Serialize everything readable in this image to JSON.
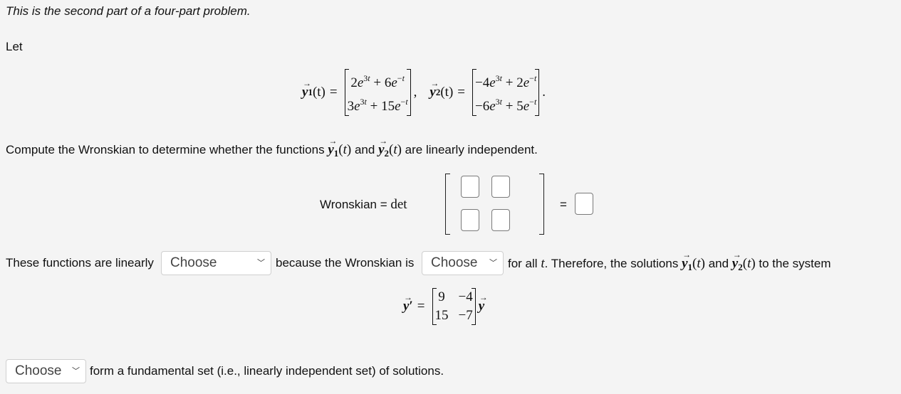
{
  "intro": "This is the second part of a four-part problem.",
  "let": "Let",
  "functions": {
    "y1_label": "y",
    "y1_sub": "1",
    "y2_label": "y",
    "y2_sub": "2",
    "arg": "(t)",
    "eq": "=",
    "y1_entries": [
      "2e^{3t} + 6e^{-t}",
      "3e^{3t} + 15e^{-t}"
    ],
    "y2_entries": [
      "-4e^{3t} + 2e^{-t}",
      "-6e^{3t} + 5e^{-t}"
    ]
  },
  "compute_text": {
    "before": "Compute the Wronskian to determine whether the functions",
    "and": "and",
    "after": "are linearly independent."
  },
  "wronskian": {
    "label": "Wronskian = ",
    "det": "det",
    "equals": "=",
    "matrix_inputs": [
      "",
      "",
      "",
      ""
    ],
    "result_input": ""
  },
  "sentence1": {
    "part1": "These functions are linearly",
    "select1": "Choose",
    "part2": "because the Wronskian is",
    "select2": "Choose",
    "part3": "for all",
    "t": "t",
    "part4": ". Therefore, the solutions",
    "and": "and",
    "part5": "to the system"
  },
  "system": {
    "lhs": "y'",
    "eq": "=",
    "matrix": [
      [
        "9",
        "-4"
      ],
      [
        "15",
        "-7"
      ]
    ],
    "rhs": "y"
  },
  "sentence2": {
    "select3": "Choose",
    "text": "form a fundamental set (i.e., linearly independent set) of solutions."
  }
}
